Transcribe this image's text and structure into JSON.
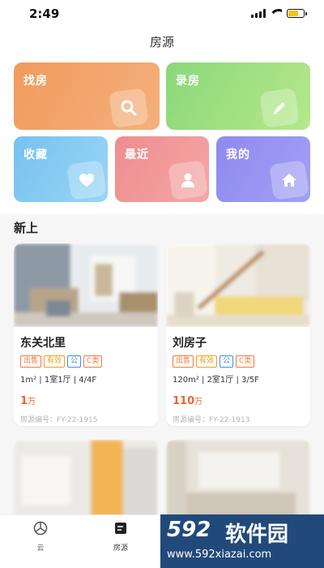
{
  "status_bar": {
    "time": "2:49"
  },
  "nav": {
    "title": "房源"
  },
  "tiles": {
    "find": "找房",
    "record": "录房",
    "favorites": "收藏",
    "recent": "最近",
    "mine": "我的"
  },
  "section": {
    "title": "新上"
  },
  "listings": [
    {
      "title": "东关北里",
      "tags": [
        "出售",
        "有效",
        "公",
        "C类"
      ],
      "specs": "1m² | 1室1厅 | 4/4F",
      "price": "1",
      "price_unit": "万",
      "code": "房源编号：FY-22-1915"
    },
    {
      "title": "刘房子",
      "tags": [
        "出售",
        "有效",
        "公",
        "C类"
      ],
      "specs": "120m² | 2室1厅 | 3/5F",
      "price": "110",
      "price_unit": "万",
      "code": "房源编号：FY-22-1913"
    }
  ],
  "tabbar": {
    "cloud": "云",
    "houses": "房源"
  },
  "watermark": {
    "brand_num": "592",
    "brand_text": "软件园",
    "url": "www.592xiazai.com"
  },
  "colors": {
    "price": "#f0642b",
    "tile_find": "#f19b5e",
    "tile_record": "#8ad87a",
    "tile_fav": "#75c2f0",
    "tile_recent": "#ee8d8f",
    "tile_mine": "#8e8af0"
  }
}
